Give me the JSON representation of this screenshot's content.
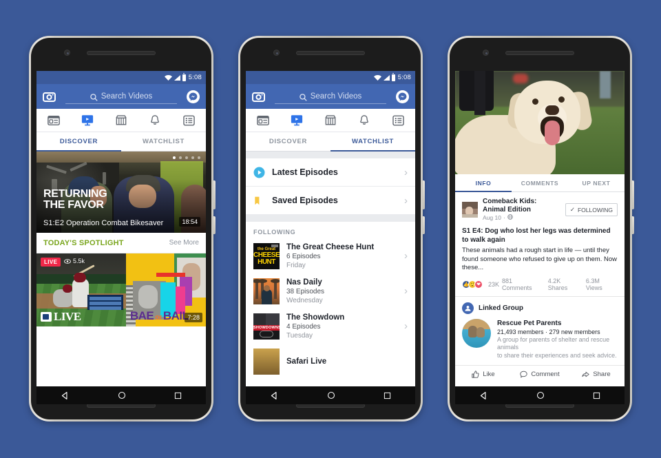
{
  "background_color": "#3b5998",
  "phones": {
    "discover": {
      "status_bar": {
        "time": "5:08",
        "icons": [
          "wifi-icon",
          "signal-icon",
          "battery-icon"
        ]
      },
      "search": {
        "placeholder": "Search Videos",
        "camera_icon": "camera-icon",
        "messenger_icon": "messenger-icon",
        "search_icon": "search-icon"
      },
      "nav_icons": [
        "news-feed-icon",
        "video-icon",
        "marketplace-icon",
        "notifications-icon",
        "menu-icon"
      ],
      "active_nav": "video-icon",
      "tabs": [
        {
          "label": "DISCOVER",
          "active": true
        },
        {
          "label": "WATCHLIST",
          "active": false
        }
      ],
      "hero": {
        "title_line1": "RETURNING",
        "title_line2": "THE FAVOR",
        "subtitle": "S1:E2 Operation Combat Bikesaver",
        "duration": "18:54",
        "carousel_dots": 5,
        "carousel_active_index": 0
      },
      "spotlight": {
        "title": "TODAY'S SPOTLIGHT",
        "title_color": "#7aa61e",
        "see_more": "See More"
      },
      "cards": [
        {
          "live_badge": "LIVE",
          "views": "5.5k",
          "brand": "LIVE",
          "eye_icon": "eye-icon"
        },
        {
          "title_a": "BAE",
          "title_or": "or",
          "title_b": "BAIL",
          "duration": "7:28"
        },
        {
          "title": ""
        }
      ]
    },
    "watchlist": {
      "status_bar": {
        "time": "5:08"
      },
      "search": {
        "placeholder": "Search Videos"
      },
      "tabs": [
        {
          "label": "DISCOVER",
          "active": false
        },
        {
          "label": "WATCHLIST",
          "active": true
        }
      ],
      "rows": [
        {
          "label": "Latest Episodes",
          "icon": "play-circle-icon",
          "chevron": "›"
        },
        {
          "label": "Saved Episodes",
          "icon": "bookmark-icon",
          "chevron": "›"
        }
      ],
      "section_header": "FOLLOWING",
      "shows": [
        {
          "name": "The Great Cheese Hunt",
          "episodes": "6 Episodes",
          "day": "Friday",
          "thumb_text_small": "the Great",
          "thumb_line1": "CHEESE",
          "thumb_line2": "HUNT"
        },
        {
          "name": "Nas Daily",
          "episodes": "38 Episodes",
          "day": "Wednesday"
        },
        {
          "name": "The Showdown",
          "episodes": "4 Episodes",
          "day": "Tuesday",
          "thumb_band": "SHOWDOWNS"
        },
        {
          "name": "Safari Live",
          "episodes": "",
          "day": ""
        }
      ]
    },
    "video_detail": {
      "tabs": [
        {
          "label": "INFO",
          "active": true
        },
        {
          "label": "COMMENTS",
          "active": false
        },
        {
          "label": "UP NEXT",
          "active": false
        }
      ],
      "post": {
        "page_name": "Comeback Kids: Animal Edition",
        "date": "Aug 10",
        "date_separator": "·",
        "privacy_icon": "globe-icon",
        "following_label": "FOLLOWING",
        "following_check": "✓",
        "title": "S1 E4: Dog who lost her legs was determined to walk again",
        "body": "These animals had a rough start in life — until they found someone who refused to give up on them. Now these...",
        "reactions": [
          "like-reaction",
          "wow-reaction",
          "love-reaction"
        ],
        "reaction_count": "23K",
        "comments": "881 Comments",
        "shares": "4.2K Shares",
        "views": "6.3M Views"
      },
      "linked_group": {
        "section_title": "Linked Group",
        "icon": "group-icon",
        "name": "Rescue Pet Parents",
        "members": "21,493 members · 279 new members",
        "description_line1": "A group for parents of shelter and rescue animals",
        "description_line2": "to share their experiences and seek advice."
      },
      "actions": [
        {
          "label": "Like",
          "icon": "thumbs-up-icon"
        },
        {
          "label": "Comment",
          "icon": "comment-icon"
        },
        {
          "label": "Share",
          "icon": "share-icon"
        }
      ]
    }
  },
  "android_nav": [
    "back-icon",
    "home-icon",
    "recents-icon"
  ]
}
